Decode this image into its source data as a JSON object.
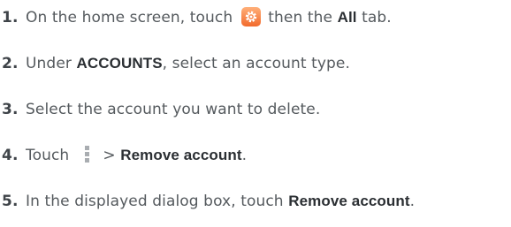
{
  "steps": [
    {
      "num": "1",
      "before": "On the home screen, touch",
      "after": "then the",
      "bold": "All",
      "tail": "tab."
    },
    {
      "num": "2",
      "before": "Under",
      "bold": "ACCOUNTS",
      "after": ", select an account type."
    },
    {
      "num": "3",
      "text": "Select the account you want to delete."
    },
    {
      "num": "4",
      "before": "Touch",
      "after": ">",
      "bold": "Remove account",
      "tail": "."
    },
    {
      "num": "5",
      "before": "In the displayed dialog box, touch",
      "bold": "Remove account",
      "tail": "."
    }
  ],
  "icons": {
    "settings": "settings-gear-icon",
    "menu": "overflow-menu-icon"
  },
  "colors": {
    "text": "#555a5e",
    "bold": "#2b2f33",
    "settings_icon": "#f26a2c",
    "menu_icon": "#a9adb1"
  }
}
